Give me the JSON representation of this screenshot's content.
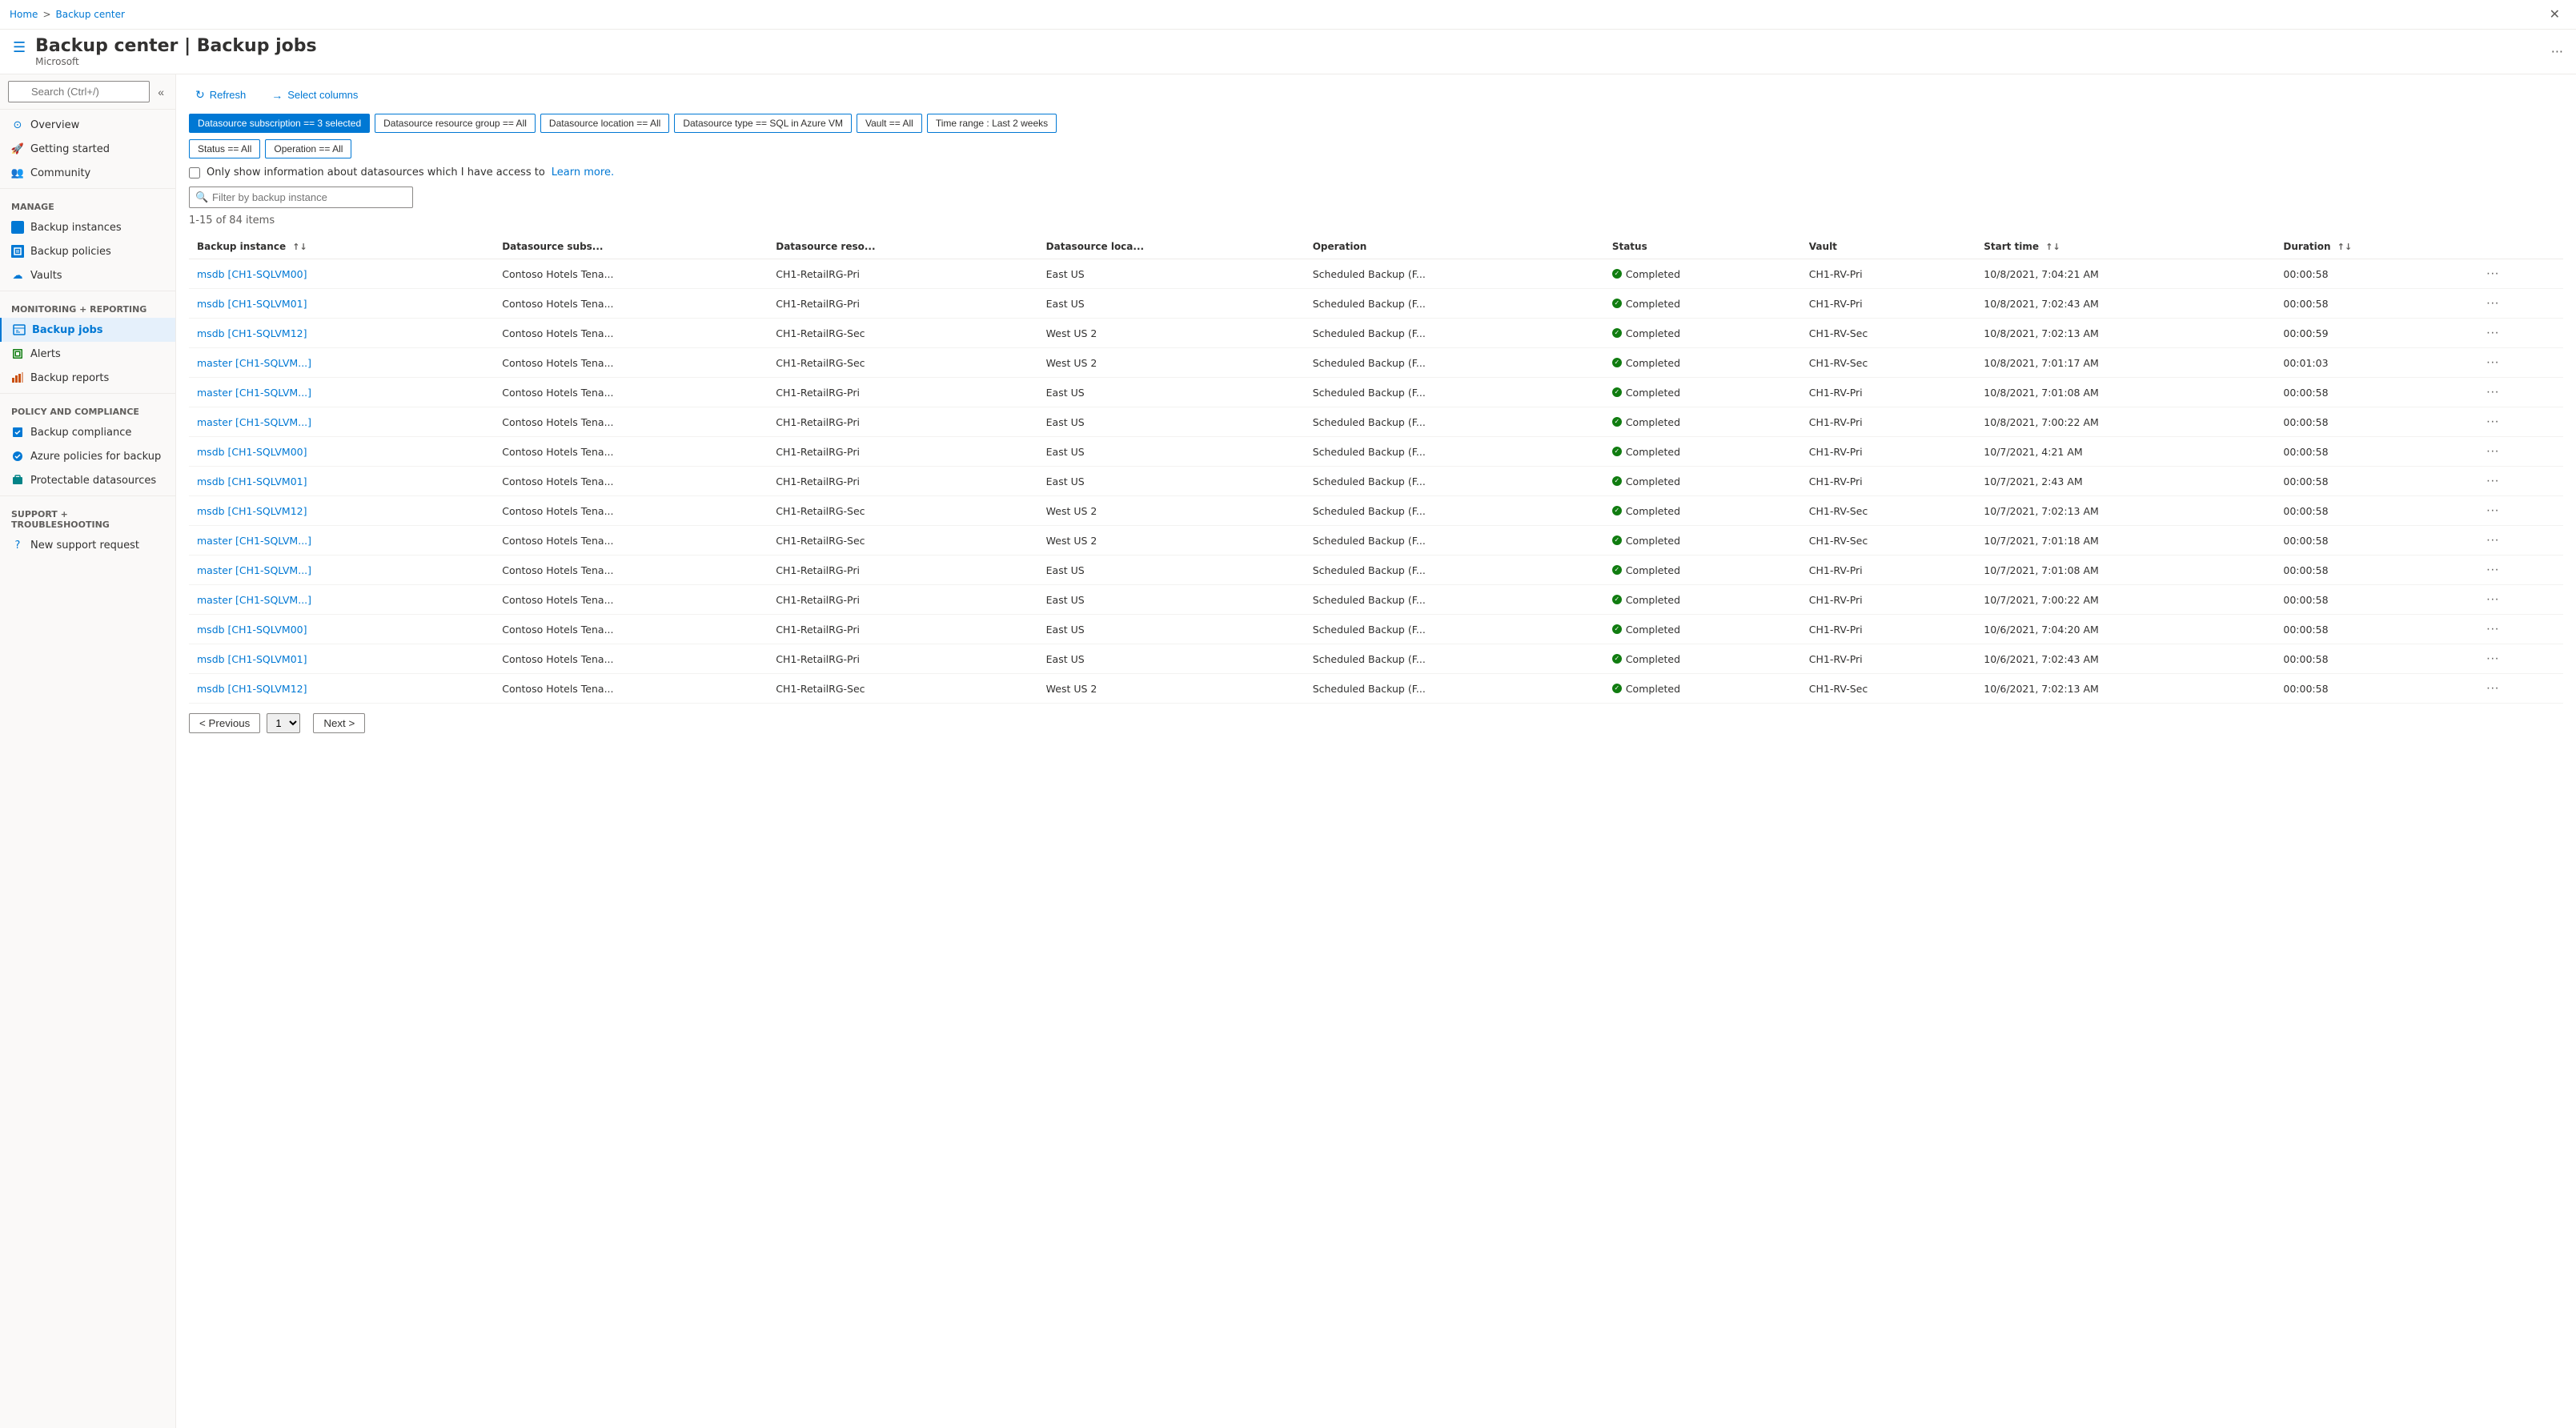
{
  "breadcrumb": {
    "home": "Home",
    "section": "Backup center"
  },
  "header": {
    "title": "Backup center | Backup jobs",
    "subtitle": "Microsoft",
    "more_label": "···"
  },
  "sidebar": {
    "search_placeholder": "Search (Ctrl+/)",
    "items": [
      {
        "id": "overview",
        "label": "Overview",
        "icon": "overview"
      },
      {
        "id": "getting-started",
        "label": "Getting started",
        "icon": "info"
      },
      {
        "id": "community",
        "label": "Community",
        "icon": "community"
      }
    ],
    "manage_section": "Manage",
    "manage_items": [
      {
        "id": "backup-instances",
        "label": "Backup instances",
        "icon": "instances"
      },
      {
        "id": "backup-policies",
        "label": "Backup policies",
        "icon": "policies"
      },
      {
        "id": "vaults",
        "label": "Vaults",
        "icon": "vaults"
      }
    ],
    "monitoring_section": "Monitoring + reporting",
    "monitoring_items": [
      {
        "id": "backup-jobs",
        "label": "Backup jobs",
        "icon": "jobs",
        "active": true
      },
      {
        "id": "alerts",
        "label": "Alerts",
        "icon": "alerts"
      },
      {
        "id": "backup-reports",
        "label": "Backup reports",
        "icon": "reports"
      }
    ],
    "policy_section": "Policy and compliance",
    "policy_items": [
      {
        "id": "backup-compliance",
        "label": "Backup compliance",
        "icon": "compliance"
      },
      {
        "id": "azure-policies",
        "label": "Azure policies for backup",
        "icon": "azure-policy"
      },
      {
        "id": "protectable-datasources",
        "label": "Protectable datasources",
        "icon": "datasources"
      }
    ],
    "support_section": "Support + troubleshooting",
    "support_items": [
      {
        "id": "new-support",
        "label": "New support request",
        "icon": "support"
      }
    ]
  },
  "toolbar": {
    "refresh_label": "Refresh",
    "select_columns_label": "Select columns"
  },
  "filters": [
    {
      "id": "subscription",
      "label": "Datasource subscription == 3 selected",
      "active": true
    },
    {
      "id": "resource-group",
      "label": "Datasource resource group == All",
      "active": false
    },
    {
      "id": "location",
      "label": "Datasource location == All",
      "active": false
    },
    {
      "id": "type",
      "label": "Datasource type == SQL in Azure VM",
      "active": false
    },
    {
      "id": "vault",
      "label": "Vault == All",
      "active": false
    },
    {
      "id": "time-range",
      "label": "Time range : Last 2 weeks",
      "active": false
    },
    {
      "id": "status",
      "label": "Status == All",
      "active": false
    },
    {
      "id": "operation",
      "label": "Operation == All",
      "active": false
    }
  ],
  "checkbox": {
    "label": "Only show information about datasources which I have access to",
    "learn_more": "Learn more."
  },
  "filter_input": {
    "placeholder": "Filter by backup instance"
  },
  "item_count": "1-15 of 84 items",
  "table": {
    "headers": [
      {
        "id": "backup-instance",
        "label": "Backup instance",
        "sortable": true
      },
      {
        "id": "datasource-subs",
        "label": "Datasource subs...",
        "sortable": false
      },
      {
        "id": "datasource-reso",
        "label": "Datasource reso...",
        "sortable": false
      },
      {
        "id": "datasource-loca",
        "label": "Datasource loca...",
        "sortable": false
      },
      {
        "id": "operation",
        "label": "Operation",
        "sortable": false
      },
      {
        "id": "status",
        "label": "Status",
        "sortable": false
      },
      {
        "id": "vault",
        "label": "Vault",
        "sortable": false
      },
      {
        "id": "start-time",
        "label": "Start time",
        "sortable": true
      },
      {
        "id": "duration",
        "label": "Duration",
        "sortable": true
      },
      {
        "id": "actions",
        "label": "",
        "sortable": false
      }
    ],
    "rows": [
      {
        "instance": "msdb [CH1-SQLVM00]",
        "subs": "Contoso Hotels Tena...",
        "resource": "CH1-RetailRG-Pri",
        "location": "East US",
        "operation": "Scheduled Backup (F...",
        "status": "Completed",
        "vault": "CH1-RV-Pri",
        "start_time": "10/8/2021, 7:04:21 AM",
        "duration": "00:00:58"
      },
      {
        "instance": "msdb [CH1-SQLVM01]",
        "subs": "Contoso Hotels Tena...",
        "resource": "CH1-RetailRG-Pri",
        "location": "East US",
        "operation": "Scheduled Backup (F...",
        "status": "Completed",
        "vault": "CH1-RV-Pri",
        "start_time": "10/8/2021, 7:02:43 AM",
        "duration": "00:00:58"
      },
      {
        "instance": "msdb [CH1-SQLVM12]",
        "subs": "Contoso Hotels Tena...",
        "resource": "CH1-RetailRG-Sec",
        "location": "West US 2",
        "operation": "Scheduled Backup (F...",
        "status": "Completed",
        "vault": "CH1-RV-Sec",
        "start_time": "10/8/2021, 7:02:13 AM",
        "duration": "00:00:59"
      },
      {
        "instance": "master [CH1-SQLVM...]",
        "subs": "Contoso Hotels Tena...",
        "resource": "CH1-RetailRG-Sec",
        "location": "West US 2",
        "operation": "Scheduled Backup (F...",
        "status": "Completed",
        "vault": "CH1-RV-Sec",
        "start_time": "10/8/2021, 7:01:17 AM",
        "duration": "00:01:03"
      },
      {
        "instance": "master [CH1-SQLVM...]",
        "subs": "Contoso Hotels Tena...",
        "resource": "CH1-RetailRG-Pri",
        "location": "East US",
        "operation": "Scheduled Backup (F...",
        "status": "Completed",
        "vault": "CH1-RV-Pri",
        "start_time": "10/8/2021, 7:01:08 AM",
        "duration": "00:00:58"
      },
      {
        "instance": "master [CH1-SQLVM...]",
        "subs": "Contoso Hotels Tena...",
        "resource": "CH1-RetailRG-Pri",
        "location": "East US",
        "operation": "Scheduled Backup (F...",
        "status": "Completed",
        "vault": "CH1-RV-Pri",
        "start_time": "10/8/2021, 7:00:22 AM",
        "duration": "00:00:58"
      },
      {
        "instance": "msdb [CH1-SQLVM00]",
        "subs": "Contoso Hotels Tena...",
        "resource": "CH1-RetailRG-Pri",
        "location": "East US",
        "operation": "Scheduled Backup (F...",
        "status": "Completed",
        "vault": "CH1-RV-Pri",
        "start_time": "10/7/2021, 4:21 AM",
        "duration": "00:00:58"
      },
      {
        "instance": "msdb [CH1-SQLVM01]",
        "subs": "Contoso Hotels Tena...",
        "resource": "CH1-RetailRG-Pri",
        "location": "East US",
        "operation": "Scheduled Backup (F...",
        "status": "Completed",
        "vault": "CH1-RV-Pri",
        "start_time": "10/7/2021, 2:43 AM",
        "duration": "00:00:58"
      },
      {
        "instance": "msdb [CH1-SQLVM12]",
        "subs": "Contoso Hotels Tena...",
        "resource": "CH1-RetailRG-Sec",
        "location": "West US 2",
        "operation": "Scheduled Backup (F...",
        "status": "Completed",
        "vault": "CH1-RV-Sec",
        "start_time": "10/7/2021, 7:02:13 AM",
        "duration": "00:00:58"
      },
      {
        "instance": "master [CH1-SQLVM...]",
        "subs": "Contoso Hotels Tena...",
        "resource": "CH1-RetailRG-Sec",
        "location": "West US 2",
        "operation": "Scheduled Backup (F...",
        "status": "Completed",
        "vault": "CH1-RV-Sec",
        "start_time": "10/7/2021, 7:01:18 AM",
        "duration": "00:00:58"
      },
      {
        "instance": "master [CH1-SQLVM...]",
        "subs": "Contoso Hotels Tena...",
        "resource": "CH1-RetailRG-Pri",
        "location": "East US",
        "operation": "Scheduled Backup (F...",
        "status": "Completed",
        "vault": "CH1-RV-Pri",
        "start_time": "10/7/2021, 7:01:08 AM",
        "duration": "00:00:58"
      },
      {
        "instance": "master [CH1-SQLVM...]",
        "subs": "Contoso Hotels Tena...",
        "resource": "CH1-RetailRG-Pri",
        "location": "East US",
        "operation": "Scheduled Backup (F...",
        "status": "Completed",
        "vault": "CH1-RV-Pri",
        "start_time": "10/7/2021, 7:00:22 AM",
        "duration": "00:00:58"
      },
      {
        "instance": "msdb [CH1-SQLVM00]",
        "subs": "Contoso Hotels Tena...",
        "resource": "CH1-RetailRG-Pri",
        "location": "East US",
        "operation": "Scheduled Backup (F...",
        "status": "Completed",
        "vault": "CH1-RV-Pri",
        "start_time": "10/6/2021, 7:04:20 AM",
        "duration": "00:00:58"
      },
      {
        "instance": "msdb [CH1-SQLVM01]",
        "subs": "Contoso Hotels Tena...",
        "resource": "CH1-RetailRG-Pri",
        "location": "East US",
        "operation": "Scheduled Backup (F...",
        "status": "Completed",
        "vault": "CH1-RV-Pri",
        "start_time": "10/6/2021, 7:02:43 AM",
        "duration": "00:00:58"
      },
      {
        "instance": "msdb [CH1-SQLVM12]",
        "subs": "Contoso Hotels Tena...",
        "resource": "CH1-RetailRG-Sec",
        "location": "West US 2",
        "operation": "Scheduled Backup (F...",
        "status": "Completed",
        "vault": "CH1-RV-Sec",
        "start_time": "10/6/2021, 7:02:13 AM",
        "duration": "00:00:58"
      }
    ]
  },
  "pagination": {
    "prev_label": "< Previous",
    "next_label": "Next >",
    "current_page": "1"
  }
}
